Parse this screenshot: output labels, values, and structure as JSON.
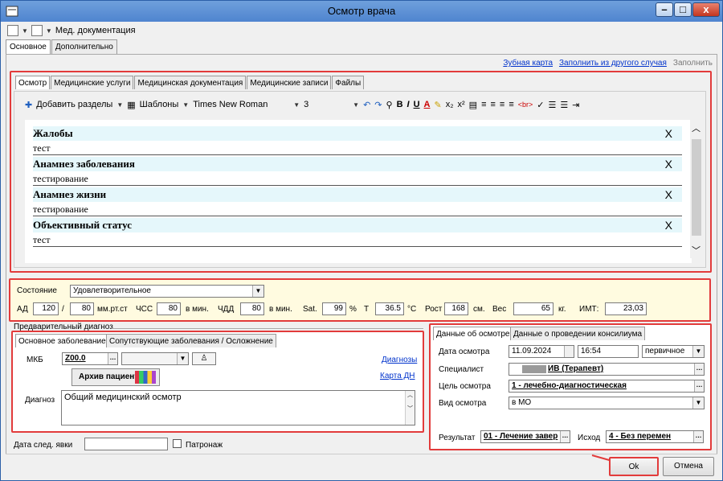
{
  "window": {
    "title": "Осмотр врача"
  },
  "top_toolbar": {
    "menu_label": "Мед. документация"
  },
  "main_tabs": [
    {
      "label": "Основное"
    },
    {
      "label": "Дополнительно"
    }
  ],
  "links": {
    "dental_chart": "Зубная карта",
    "fill_from_other": "Заполнить из другого случая",
    "fill": "Заполнить"
  },
  "sub_tabs": [
    {
      "label": "Осмотр"
    },
    {
      "label": "Медицинские услуги"
    },
    {
      "label": "Медицинская документация"
    },
    {
      "label": "Медицинские записи"
    },
    {
      "label": "Файлы"
    }
  ],
  "editor_toolbar": {
    "add_sections": "Добавить разделы",
    "templates": "Шаблоны",
    "font": "Times New Roman",
    "size": "3",
    "br_label": "<br>",
    "imt_label": "ИМТ:"
  },
  "sections": [
    {
      "title": "Жалобы",
      "text": "тест",
      "remove": "X"
    },
    {
      "title": "Анамнез заболевания",
      "text": "тестирование",
      "remove": "X"
    },
    {
      "title": "Анамнез жизни",
      "text": "тестирование",
      "remove": "X"
    },
    {
      "title": "Объективный статус",
      "text": "тест",
      "remove": "X"
    }
  ],
  "vitals": {
    "state_label": "Состояние",
    "state_value": "Удовлетворительное",
    "ad_label": "АД",
    "ad_sys": "120",
    "ad_sep": "/",
    "ad_dia": "80",
    "ad_unit": "мм.рт.ст",
    "hss_label": "ЧСС",
    "hss_value": "80",
    "hss_unit": "в мин.",
    "chdd_label": "ЧДД",
    "chdd_value": "80",
    "chdd_unit": "в мин.",
    "sat_label": "Sat.",
    "sat_value": "99",
    "sat_unit": "%",
    "t_label": "T",
    "t_value": "36.5",
    "t_unit": "°C",
    "height_label": "Рост",
    "height_value": "168",
    "height_unit": "см.",
    "weight_label": "Вес",
    "weight_value": "65",
    "weight_unit": "кг.",
    "imt_label": "ИМТ:",
    "imt_value": "23,03"
  },
  "diagnosis": {
    "group_title": "Предварительный диагноз",
    "tabs": [
      {
        "label": "Основное заболевание"
      },
      {
        "label": "Сопутствующие заболевания / Осложнение"
      }
    ],
    "mkb_label": "МКБ",
    "mkb_value": "Z00.0",
    "diagnoses_link": "Диагнозы",
    "dn_card_link": "Карта ДН",
    "archive_button": "Архив пациента",
    "diag_label": "Диагноз",
    "diag_value": "Общий медицинский осмотр"
  },
  "next_visit": {
    "label": "Дата след. явки",
    "patronage_label": "Патронаж"
  },
  "exam_info": {
    "tabs": [
      {
        "label": "Данные об осмотре"
      },
      {
        "label": "Данные о проведении консилиума"
      }
    ],
    "date_label": "Дата осмотра",
    "date_value": "11.09.2024",
    "time_value": "16:54",
    "kind_value": "первичное",
    "specialist_label": "Специалист",
    "specialist_value": "ИВ (Терапевт)",
    "purpose_label": "Цель осмотра",
    "purpose_value": "1 - лечебно-диагностическая",
    "type_label": "Вид осмотра",
    "type_value": "в МО",
    "result_label": "Результат",
    "result_value": "01 - Лечение завер",
    "outcome_label": "Исход",
    "outcome_value": "4 - Без перемен"
  },
  "buttons": {
    "ok": "Ok",
    "cancel": "Отмена"
  }
}
